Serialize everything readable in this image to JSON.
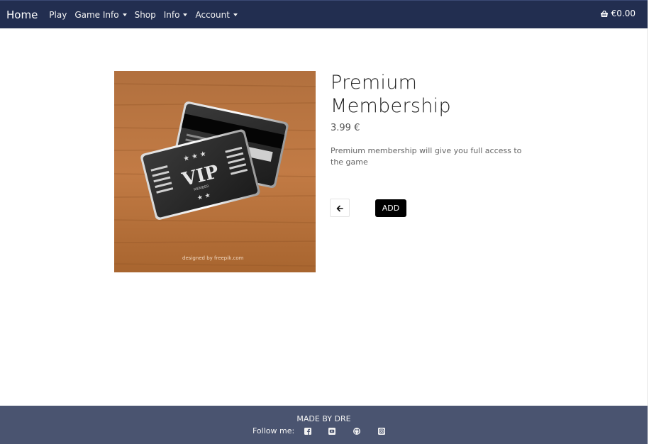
{
  "navbar": {
    "brand": "Home",
    "links": [
      {
        "label": "Play",
        "dropdown": false
      },
      {
        "label": "Game Info",
        "dropdown": true
      },
      {
        "label": "Shop",
        "dropdown": false
      },
      {
        "label": "Info",
        "dropdown": true
      },
      {
        "label": "Account",
        "dropdown": true
      }
    ],
    "cart_total": "€0.00",
    "cart_icon": "basket-icon"
  },
  "product": {
    "title": "Premium Membership",
    "price": "3.99 €",
    "description": "Premium membership will give you full access to the game",
    "image_caption": "designed by freepik.com",
    "back_icon": "arrow-left-icon",
    "add_label": "ADD"
  },
  "footer": {
    "credit": "MADE BY DRE",
    "follow_label": "Follow me:",
    "social_icons": [
      "facebook-icon",
      "youtube-icon",
      "github-icon",
      "instagram-icon"
    ]
  },
  "colors": {
    "navbar_bg": "#222e50",
    "footer_bg": "#4a5470",
    "add_button_bg": "#000000"
  }
}
